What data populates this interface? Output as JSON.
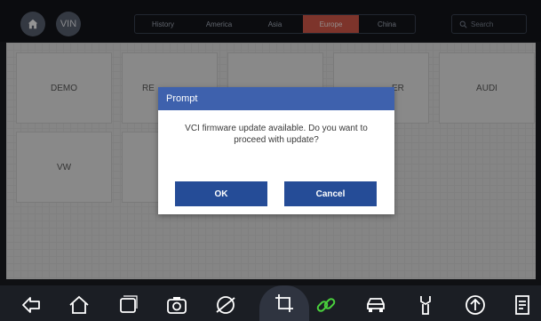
{
  "topbar": {
    "home_icon": "home-icon",
    "vin_label": "VIN",
    "tabs": [
      "History",
      "America",
      "Asia",
      "Europe",
      "China"
    ],
    "active_tab": "Europe",
    "search_placeholder": "Search"
  },
  "tiles": {
    "demo": "DEMO",
    "re": "RE",
    "er": "ER",
    "audi": "AUDI",
    "vw": "VW"
  },
  "dialog": {
    "title": "Prompt",
    "message": "VCI firmware update available. Do you want to proceed with update?",
    "ok_label": "OK",
    "cancel_label": "Cancel"
  },
  "colors": {
    "active_tab": "#d85a4a",
    "dialog_header": "#3e61ad",
    "button": "#254c97",
    "link_icon_green": "#4ad13d"
  },
  "bottom_nav_icons": [
    "back-icon",
    "home-icon",
    "recent-apps-icon",
    "camera-icon",
    "browser-icon",
    "crop-icon",
    "link-icon",
    "car-icon",
    "wrench-icon",
    "upload-icon",
    "document-icon"
  ]
}
